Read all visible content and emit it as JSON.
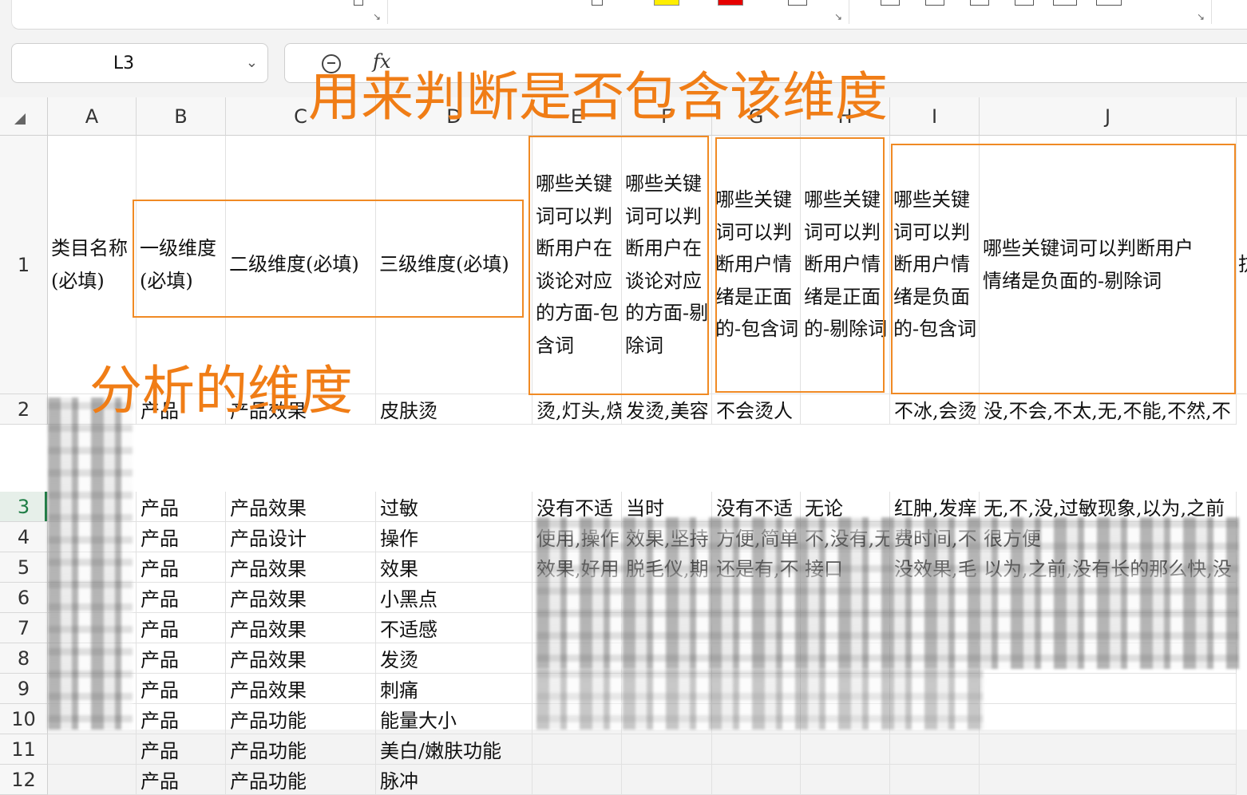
{
  "name_box": {
    "value": "L3"
  },
  "formula_bar": {
    "fx_label": "fx",
    "value": ""
  },
  "columns": [
    "A",
    "B",
    "C",
    "D",
    "E",
    "F",
    "G",
    "H",
    "I",
    "J"
  ],
  "header_row": {
    "number": "1",
    "cells": [
      "类目名称(必填)",
      "一级维度(必填)",
      "二级维度(必填)",
      "三级维度(必填)",
      "哪些关键词可以判断用户在谈论对应的方面-包含词",
      "哪些关键词可以判断用户在谈论对应的方面-剔除词",
      "哪些关键词可以判断用户情绪是正面的-包含词",
      "哪些关键词可以判断用户情绪是正面的-剔除词",
      "哪些关键词可以判断用户情绪是负面的-包含词",
      "哪些关键词可以判断用户情绪是负面的-剔除词"
    ],
    "overflow_char": "抗"
  },
  "rows": [
    {
      "num": "2",
      "b": "产品",
      "c": "产品效果",
      "d": "皮肤烫",
      "e": "烫,灯头,烧",
      "f": "发烫,美容",
      "g": "不会烫人",
      "h": "",
      "i": "不冰,会烫",
      "j": "没,不会,不太,无,不能,不然,不"
    },
    {
      "num": "3",
      "b": "产品",
      "c": "产品效果",
      "d": "过敏",
      "e": "没有不适",
      "f": "当时",
      "g": "没有不适",
      "h": "无论",
      "i": "红肿,发痒",
      "j": "无,不,没,过敏现象,以为,之前"
    },
    {
      "num": "4",
      "b": "产品",
      "c": "产品设计",
      "d": "操作",
      "e": "使用,操作",
      "f": "效果,坚持",
      "g": "方便,简单",
      "h": "不,没有,无",
      "i": "费时间,不",
      "j": "很方便"
    },
    {
      "num": "5",
      "b": "产品",
      "c": "产品效果",
      "d": "效果",
      "e": "效果,好用",
      "f": "脱毛仪,期",
      "g": "还是有,不",
      "h": "接口",
      "i": "没效果,毛",
      "j": "以为,之前,没有长的那么快,没"
    },
    {
      "num": "6",
      "b": "产品",
      "c": "产品效果",
      "d": "小黑点"
    },
    {
      "num": "7",
      "b": "产品",
      "c": "产品效果",
      "d": "不适感"
    },
    {
      "num": "8",
      "b": "产品",
      "c": "产品效果",
      "d": "发烫"
    },
    {
      "num": "9",
      "b": "产品",
      "c": "产品效果",
      "d": "刺痛"
    },
    {
      "num": "10",
      "b": "产品",
      "c": "产品功能",
      "d": "能量大小"
    },
    {
      "num": "11",
      "b": "产品",
      "c": "产品功能",
      "d": "美白/嫩肤功能"
    },
    {
      "num": "12",
      "b": "产品",
      "c": "产品功能",
      "d": "脉冲"
    }
  ],
  "annotations": {
    "top": "用来判断是否包含该维度",
    "left": "分析的维度"
  },
  "colors": {
    "annotation": "#f07d16",
    "selection": "#1e7d45"
  }
}
